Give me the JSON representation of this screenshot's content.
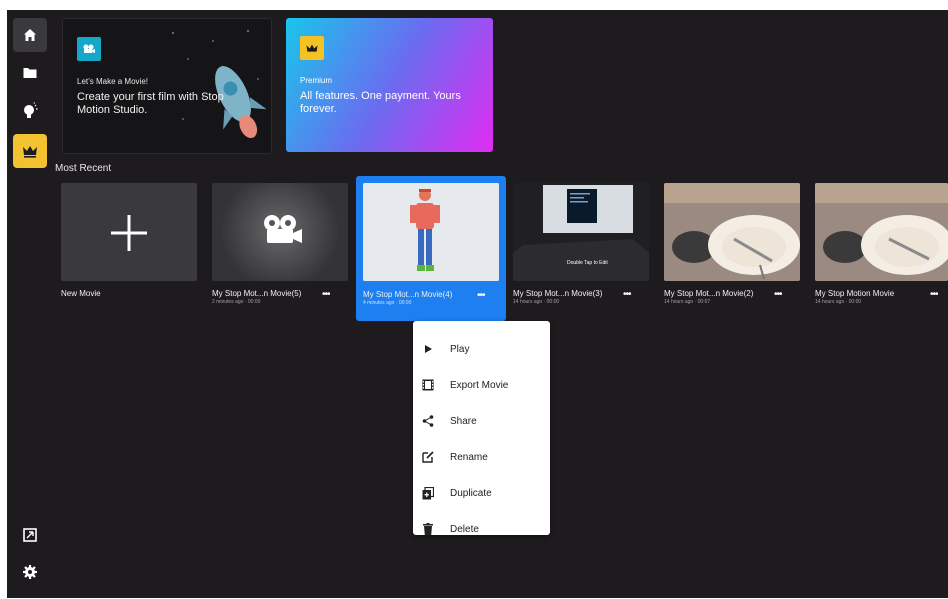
{
  "promos": {
    "make": {
      "kicker": "Let’s Make a Movie!",
      "headline": "Create your first film with Stop Motion Studio."
    },
    "premium": {
      "kicker": "Premium",
      "headline": "All features. One payment. Yours forever."
    }
  },
  "section_title": "Most Recent",
  "cards": [
    {
      "title": "New Movie",
      "meta": ""
    },
    {
      "title": "My Stop Mot...n Movie(5)",
      "meta": "2 minutes ago · 00:00"
    },
    {
      "title": "My Stop Mot...n Movie(4)",
      "meta": "4 minutes ago · 00:00"
    },
    {
      "title": "My Stop Mot...n Movie(3)",
      "meta": "14 hours ago · 00:00"
    },
    {
      "title": "My Stop Mot...n Movie(2)",
      "meta": "14 hours ago · 00:07"
    },
    {
      "title": "My Stop Motion Movie",
      "meta": "14 hours ago · 00:00"
    }
  ],
  "card_overlay_text": "Double Tap to Edit",
  "dots_label": "•••",
  "menu": [
    {
      "label": "Play",
      "icon": "play-icon"
    },
    {
      "label": "Export Movie",
      "icon": "film-icon"
    },
    {
      "label": "Share",
      "icon": "share-icon"
    },
    {
      "label": "Rename",
      "icon": "edit-icon"
    },
    {
      "label": "Duplicate",
      "icon": "duplicate-icon"
    },
    {
      "label": "Delete",
      "icon": "trash-icon"
    }
  ],
  "colors": {
    "background": "#1e1b1f",
    "accent_blue": "#1d7ff0",
    "crown_yellow": "#f2c230",
    "teal": "#16a8c8"
  }
}
